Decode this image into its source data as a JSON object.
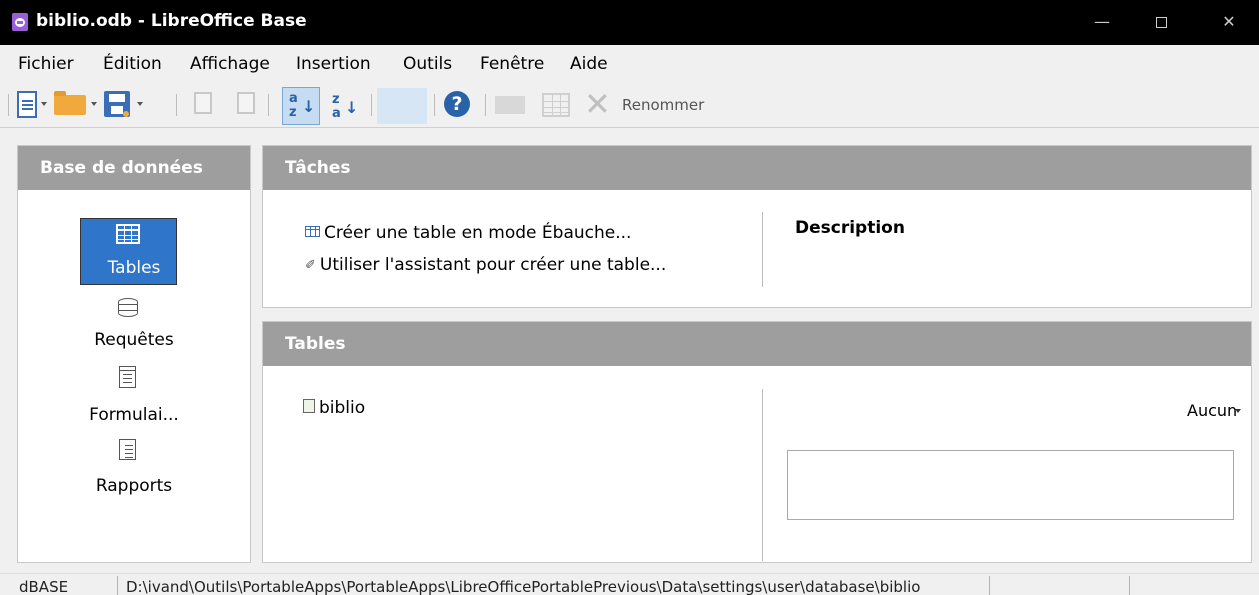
{
  "window": {
    "title": "biblio.odb - LibreOffice Base",
    "minimize": "—",
    "close": "✕"
  },
  "menu": [
    {
      "label": "Fichier"
    },
    {
      "label": "Édition"
    },
    {
      "label": "Affichage"
    },
    {
      "label": "Insertion"
    },
    {
      "label": "Outils"
    },
    {
      "label": "Fenêtre"
    },
    {
      "label": "Aide"
    }
  ],
  "toolbar": {
    "sort_asc_top": "a",
    "sort_asc_bottom": "z",
    "sort_desc_top": "z",
    "sort_desc_bottom": "a",
    "help": "?",
    "rename_label": "Renommer",
    "delete_glyph": "✕"
  },
  "left_panel": {
    "header": "Base de données",
    "items": [
      {
        "label": "Tables",
        "icon": "table-icon",
        "selected": true
      },
      {
        "label": "Requêtes",
        "icon": "database-icon",
        "selected": false
      },
      {
        "label": "Formulai...",
        "icon": "form-icon",
        "selected": false
      },
      {
        "label": "Rapports",
        "icon": "report-icon",
        "selected": false
      }
    ]
  },
  "tasks": {
    "header": "Tâches",
    "items": [
      {
        "label": "Créer une table en mode Ébauche...",
        "icon": "table-design-icon"
      },
      {
        "label": "Utiliser l'assistant pour créer une table...",
        "icon": "wizard-icon"
      }
    ],
    "description_title": "Description"
  },
  "tables": {
    "header": "Tables",
    "items": [
      {
        "label": "biblio",
        "icon": "table-doc-icon"
      }
    ],
    "preview_mode": "Aucun"
  },
  "status": {
    "db_type": "dBASE",
    "path": "D:\\ivand\\Outils\\PortableApps\\PortableApps\\LibreOfficePortablePrevious\\Data\\settings\\user\\database\\biblio",
    "cell3": "",
    "cell4": ""
  },
  "colors": {
    "title_bar": "#000000",
    "panel_header": "#9e9e9e",
    "selection": "#2f75c9",
    "accent": "#3a6fb5"
  }
}
